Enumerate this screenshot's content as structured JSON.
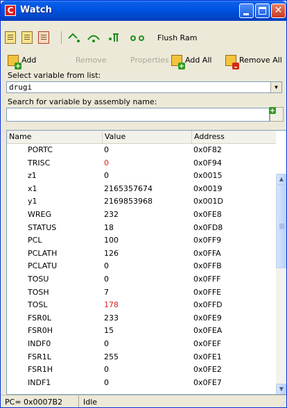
{
  "window": {
    "title": "Watch",
    "app_icon": "C",
    "close_glyph": "✕"
  },
  "toolbar1": {
    "flush_ram_label": "Flush Ram",
    "icons": [
      "doc-icon",
      "doc-icon",
      "doc-delete-icon",
      "step-into-icon",
      "step-over-icon",
      "step-out-icon",
      "run-to-cursor-icon"
    ]
  },
  "toolbar2": {
    "add_label": "Add",
    "remove_label": "Remove",
    "properties_label": "Properties",
    "add_all_label": "Add All",
    "remove_all_label": "Remove All"
  },
  "select_label": "Select variable from list:",
  "select_value": "drugi",
  "search_label": "Search for variable by assembly name:",
  "search_value": "",
  "table": {
    "columns": [
      "Name",
      "Value",
      "Address"
    ],
    "rows": [
      {
        "name": "PORTC",
        "value": "0",
        "address": "0x0F82",
        "changed": false
      },
      {
        "name": "TRISC",
        "value": "0",
        "address": "0x0F94",
        "changed": true
      },
      {
        "name": "z1",
        "value": "0",
        "address": "0x0015",
        "changed": false
      },
      {
        "name": "x1",
        "value": "2165357674",
        "address": "0x0019",
        "changed": false
      },
      {
        "name": "y1",
        "value": "2169853968",
        "address": "0x001D",
        "changed": false
      },
      {
        "name": "WREG",
        "value": "232",
        "address": "0x0FE8",
        "changed": false
      },
      {
        "name": "STATUS",
        "value": "18",
        "address": "0x0FD8",
        "changed": false
      },
      {
        "name": "PCL",
        "value": "100",
        "address": "0x0FF9",
        "changed": false
      },
      {
        "name": "PCLATH",
        "value": "126",
        "address": "0x0FFA",
        "changed": false
      },
      {
        "name": "PCLATU",
        "value": "0",
        "address": "0x0FFB",
        "changed": false
      },
      {
        "name": "TOSU",
        "value": "0",
        "address": "0x0FFF",
        "changed": false
      },
      {
        "name": "TOSH",
        "value": "7",
        "address": "0x0FFE",
        "changed": false
      },
      {
        "name": "TOSL",
        "value": "178",
        "address": "0x0FFD",
        "changed": true
      },
      {
        "name": "FSR0L",
        "value": "233",
        "address": "0x0FE9",
        "changed": false
      },
      {
        "name": "FSR0H",
        "value": "15",
        "address": "0x0FEA",
        "changed": false
      },
      {
        "name": "INDF0",
        "value": "0",
        "address": "0x0FEF",
        "changed": false
      },
      {
        "name": "FSR1L",
        "value": "255",
        "address": "0x0FE1",
        "changed": false
      },
      {
        "name": "FSR1H",
        "value": "0",
        "address": "0x0FE2",
        "changed": false
      },
      {
        "name": "INDF1",
        "value": "0",
        "address": "0x0FE7",
        "changed": false
      }
    ]
  },
  "status": {
    "pc": "PC= 0x0007B2",
    "state": "Idle"
  },
  "colors": {
    "changed_value": "#e02020",
    "titlebar": "#0054e3"
  }
}
